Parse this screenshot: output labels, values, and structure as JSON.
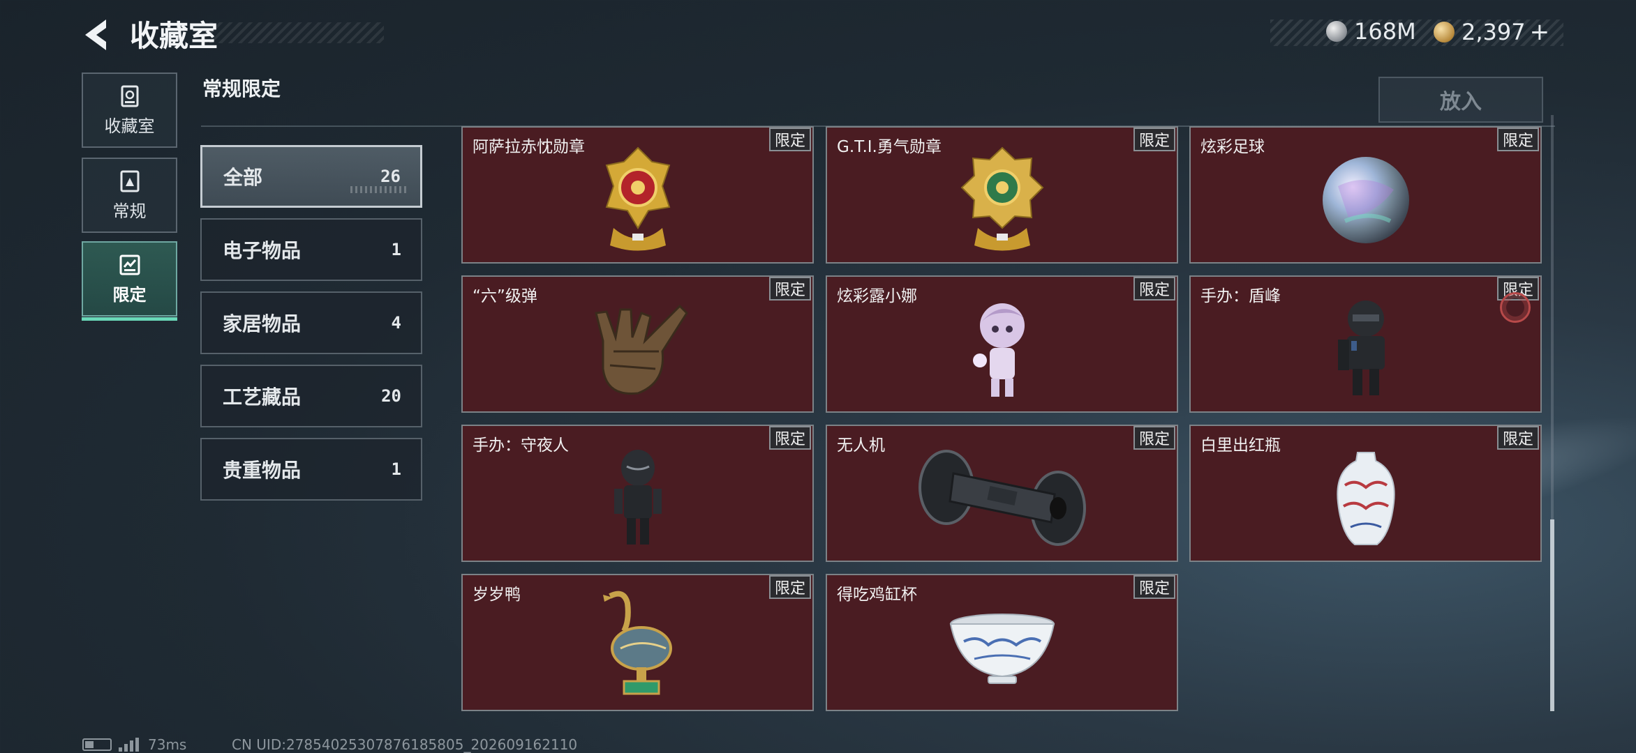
{
  "header": {
    "title": "收藏室",
    "currency_1": "168M",
    "currency_2": "2,397",
    "currency_2_plus": "+"
  },
  "nav": [
    {
      "label": "收藏室",
      "icon": "vault-icon"
    },
    {
      "label": "常规",
      "icon": "regular-icon"
    },
    {
      "label": "限定",
      "icon": "limited-icon",
      "active": true
    }
  ],
  "section": {
    "title": "常规限定",
    "place_button": "放入"
  },
  "categories": [
    {
      "label": "全部",
      "count": "26",
      "active": true
    },
    {
      "label": "电子物品",
      "count": "1"
    },
    {
      "label": "家居物品",
      "count": "4"
    },
    {
      "label": "工艺藏品",
      "count": "20"
    },
    {
      "label": "贵重物品",
      "count": "1"
    }
  ],
  "items": [
    {
      "name": "阿萨拉赤忱勋章",
      "badge": "限定",
      "icon": "red-medal-icon"
    },
    {
      "name": "G.T.I.勇气勋章",
      "badge": "限定",
      "icon": "green-medal-icon"
    },
    {
      "name": "炫彩足球",
      "badge": "限定",
      "icon": "iridescent-ball-icon"
    },
    {
      "name": "“六”级弹",
      "badge": "限定",
      "icon": "bronze-hand-icon"
    },
    {
      "name": "炫彩露小娜",
      "badge": "限定",
      "icon": "figurine-girl-icon"
    },
    {
      "name": "手办：盾峰",
      "badge": "限定",
      "icon": "armored-figure-icon"
    },
    {
      "name": "手办：守夜人",
      "badge": "限定",
      "icon": "black-figure-icon"
    },
    {
      "name": "无人机",
      "badge": "限定",
      "icon": "drone-icon"
    },
    {
      "name": "白里出红瓶",
      "badge": "限定",
      "icon": "porcelain-vase-icon"
    },
    {
      "name": "岁岁鸭",
      "badge": "限定",
      "icon": "duck-statue-icon"
    },
    {
      "name": "得吃鸡缸杯",
      "badge": "限定",
      "icon": "porcelain-cup-icon"
    }
  ],
  "footer": {
    "ping": "73ms",
    "uid": "CN UID:27854025307876185805_202609162110"
  },
  "colors": {
    "card_bg": "#4a1c22",
    "active_nav": "#69d8b8"
  }
}
